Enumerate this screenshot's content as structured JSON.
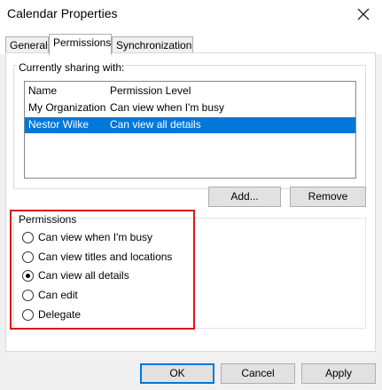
{
  "window": {
    "title": "Calendar Properties"
  },
  "tabs": [
    {
      "label": "General"
    },
    {
      "label": "Permissions"
    },
    {
      "label": "Synchronization"
    }
  ],
  "sharing": {
    "legend": "Currently sharing with:",
    "columns": [
      "Name",
      "Permission Level"
    ],
    "rows": [
      {
        "name": "My Organization",
        "level": "Can view when I'm busy",
        "selected": false
      },
      {
        "name": "Nestor Wilke",
        "level": "Can view all details",
        "selected": true
      }
    ],
    "add_label": "Add...",
    "remove_label": "Remove"
  },
  "permissions": {
    "legend": "Permissions",
    "options": [
      {
        "label": "Can view when I'm busy",
        "checked": false
      },
      {
        "label": "Can view titles and locations",
        "checked": false
      },
      {
        "label": "Can view all details",
        "checked": true
      },
      {
        "label": "Can edit",
        "checked": false
      },
      {
        "label": "Delegate",
        "checked": false
      }
    ]
  },
  "footer": {
    "ok_label": "OK",
    "cancel_label": "Cancel",
    "apply_label": "Apply"
  },
  "colors": {
    "selection": "#0078d7",
    "highlight": "#d9161c"
  }
}
